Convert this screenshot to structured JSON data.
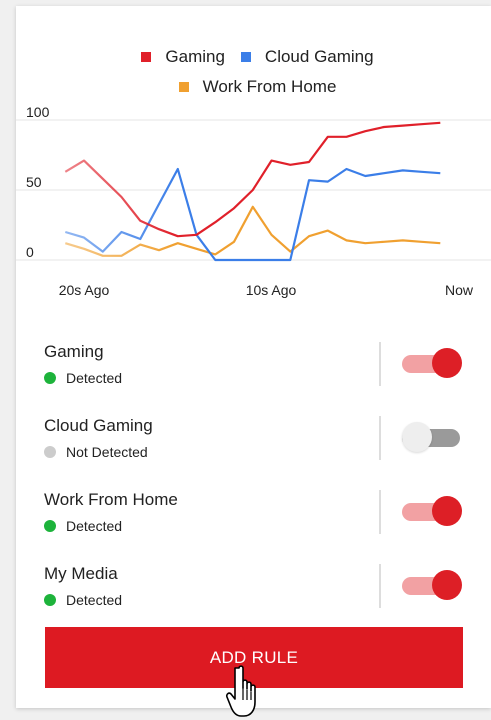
{
  "chart_data": {
    "type": "line",
    "legend_placement": "top-center",
    "legend": [
      "Gaming",
      "Cloud Gaming",
      "Work From Home"
    ],
    "x_tick_labels": [
      "20s Ago",
      "10s Ago",
      "Now"
    ],
    "y_ticks": [
      0,
      50,
      100
    ],
    "ylim": [
      -3,
      120
    ],
    "x": [
      -22,
      -20,
      -18,
      -16,
      -14,
      -12,
      -10,
      -8,
      -6,
      -4,
      -2,
      0,
      2,
      4,
      6,
      8,
      10,
      12,
      14,
      16,
      18
    ],
    "grid": true,
    "series": [
      {
        "name": "Gaming",
        "color": "#e0202a",
        "values": [
          63,
          71,
          58,
          45,
          28,
          22,
          17,
          18,
          27,
          37,
          50,
          71,
          68,
          70,
          88,
          88,
          92,
          95,
          96,
          97,
          98
        ]
      },
      {
        "name": "Cloud Gaming",
        "color": "#3b7ee8",
        "values": [
          20,
          16,
          6,
          20,
          15,
          40,
          65,
          18,
          0,
          0,
          0,
          0,
          0,
          57,
          56,
          65,
          60,
          62,
          64,
          63,
          62
        ]
      },
      {
        "name": "Work From Home",
        "color": "#f0a030",
        "values": [
          12,
          8,
          3,
          3,
          11,
          7,
          12,
          8,
          4,
          13,
          38,
          18,
          6,
          17,
          21,
          14,
          12,
          13,
          14,
          13,
          12
        ]
      }
    ]
  },
  "rules": [
    {
      "name": "Gaming",
      "status": "Detected",
      "status_color": "#1db33b",
      "enabled": true
    },
    {
      "name": "Cloud Gaming",
      "status": "Not Detected",
      "status_color": "#cccccc",
      "enabled": false
    },
    {
      "name": "Work From Home",
      "status": "Detected",
      "status_color": "#1db33b",
      "enabled": true
    },
    {
      "name": "My Media",
      "status": "Detected",
      "status_color": "#1db33b",
      "enabled": true
    }
  ],
  "add_button": {
    "label": "ADD RULE",
    "color": "#dd1a22"
  },
  "cursor_icon": "hand-pointer-icon"
}
